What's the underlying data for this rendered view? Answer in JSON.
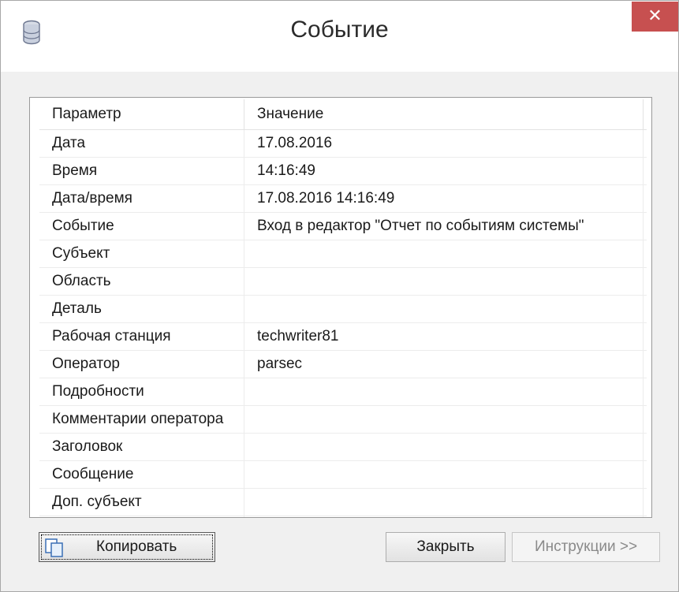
{
  "window": {
    "title": "Событие",
    "close_glyph": "✕",
    "app_icon": "database-icon"
  },
  "grid": {
    "columns": [
      "Параметр",
      "Значение"
    ],
    "rows": [
      {
        "param": "Дата",
        "value": "17.08.2016"
      },
      {
        "param": "Время",
        "value": "14:16:49"
      },
      {
        "param": "Дата/время",
        "value": "17.08.2016 14:16:49"
      },
      {
        "param": "Событие",
        "value": "Вход в редактор \"Отчет по событиям системы\""
      },
      {
        "param": "Субъект",
        "value": ""
      },
      {
        "param": "Область",
        "value": ""
      },
      {
        "param": "Деталь",
        "value": ""
      },
      {
        "param": "Рабочая станция",
        "value": "techwriter81"
      },
      {
        "param": "Оператор",
        "value": "parsec"
      },
      {
        "param": "Подробности",
        "value": ""
      },
      {
        "param": "Комментарии оператора",
        "value": ""
      },
      {
        "param": "Заголовок",
        "value": ""
      },
      {
        "param": "Сообщение",
        "value": ""
      },
      {
        "param": "Доп. субъект",
        "value": ""
      },
      {
        "param": "",
        "value": ""
      }
    ]
  },
  "buttons": {
    "copy_label": "Копировать",
    "copy_icon": "copy-icon",
    "close_label": "Закрыть",
    "instructions_label": "Инструкции >>"
  },
  "colors": {
    "close_button": "#c75050",
    "window_bg": "#f0f0f0",
    "grid_bg": "#ffffff"
  }
}
